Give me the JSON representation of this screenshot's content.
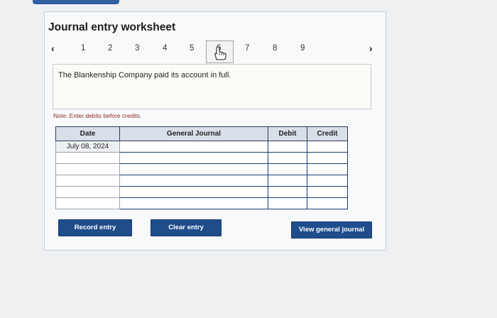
{
  "page": {
    "title": "Journal entry worksheet"
  },
  "pager": {
    "prev_icon": "chevron-left-icon",
    "next_icon": "chevron-right-icon",
    "pages": [
      "1",
      "2",
      "3",
      "4",
      "5",
      "6",
      "7",
      "8",
      "9"
    ],
    "current": "6"
  },
  "transaction": {
    "description": "The Blankenship Company paid its account in full."
  },
  "note": "Note: Enter debits before credits.",
  "journal": {
    "columns": [
      "Date",
      "General Journal",
      "Debit",
      "Credit"
    ],
    "rows": [
      {
        "date": "July 08, 2024",
        "account": "",
        "debit": "",
        "credit": ""
      },
      {
        "date": "",
        "account": "",
        "debit": "",
        "credit": ""
      },
      {
        "date": "",
        "account": "",
        "debit": "",
        "credit": ""
      },
      {
        "date": "",
        "account": "",
        "debit": "",
        "credit": ""
      },
      {
        "date": "",
        "account": "",
        "debit": "",
        "credit": ""
      },
      {
        "date": "",
        "account": "",
        "debit": "",
        "credit": ""
      }
    ]
  },
  "buttons": {
    "record": "Record entry",
    "clear": "Clear entry",
    "view": "View general journal"
  },
  "colors": {
    "button": "#1f4d8c",
    "note": "#8a2c26",
    "header_bg": "#d9dfe8"
  }
}
